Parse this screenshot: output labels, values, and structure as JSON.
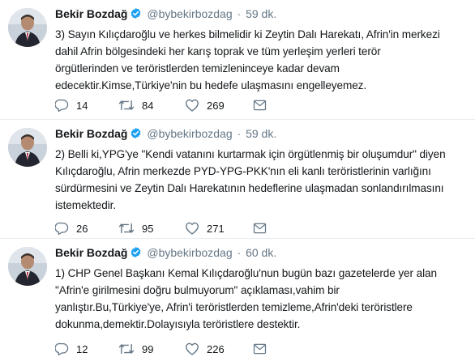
{
  "colors": {
    "verified_badge": "#1da1f2",
    "meta_text": "#657786",
    "action_icon": "#657786",
    "divider": "#e6ecf0"
  },
  "icons": {
    "reply": "speech-bubble-icon",
    "retweet": "retweet-arrows-icon",
    "like": "heart-icon",
    "dm": "envelope-icon",
    "verified": "verified-badge-icon"
  },
  "tweets": [
    {
      "name": "Bekir Bozdağ",
      "handle": "@bybekirbozdag",
      "separator": "·",
      "time": "59 dk.",
      "lines": [
        "3) Sayın Kılıçdaroğlu ve herkes bilmelidir ki Zeytin Dalı Harekatı, Afrin'in merkezi",
        "dahil Afrin bölgesindeki her karış toprak ve tüm yerleşim yerleri terör",
        "örgütlerinden ve teröristlerden temizleninceye kadar devam",
        "edecektir.Kimse,Türkiye'nin bu hedefe ulaşmasını engelleyemez."
      ],
      "replies": "14",
      "retweets": "84",
      "likes": "269"
    },
    {
      "name": "Bekir Bozdağ",
      "handle": "@bybekirbozdag",
      "separator": "·",
      "time": "59 dk.",
      "lines": [
        "2) Belli ki,YPG'ye \"Kendi vatanını kurtarmak için örgütlenmiş bir oluşumdur\" diyen",
        "Kılıçdaroğlu, Afrin merkezde PYD-YPG-PKK'nın eli kanlı teröristlerinin varlığını",
        "sürdürmesini ve Zeytin Dalı Harekatının hedeflerine ulaşmadan sonlandırılmasını",
        "istemektedir."
      ],
      "replies": "26",
      "retweets": "95",
      "likes": "271"
    },
    {
      "name": "Bekir Bozdağ",
      "handle": "@bybekirbozdag",
      "separator": "·",
      "time": "60 dk.",
      "lines": [
        "1) CHP Genel Başkanı Kemal Kılıçdaroğlu'nun bugün bazı gazetelerde yer alan",
        "\"Afrin'e girilmesini doğru bulmuyorum\" açıklaması,vahim bir",
        "yanlıştır.Bu,Türkiye'ye, Afrin'i teröristlerden temizleme,Afrin'deki teröristlere",
        "dokunma,demektir.Dolayısıyla teröristlere destektir."
      ],
      "replies": "12",
      "retweets": "99",
      "likes": "226"
    }
  ]
}
